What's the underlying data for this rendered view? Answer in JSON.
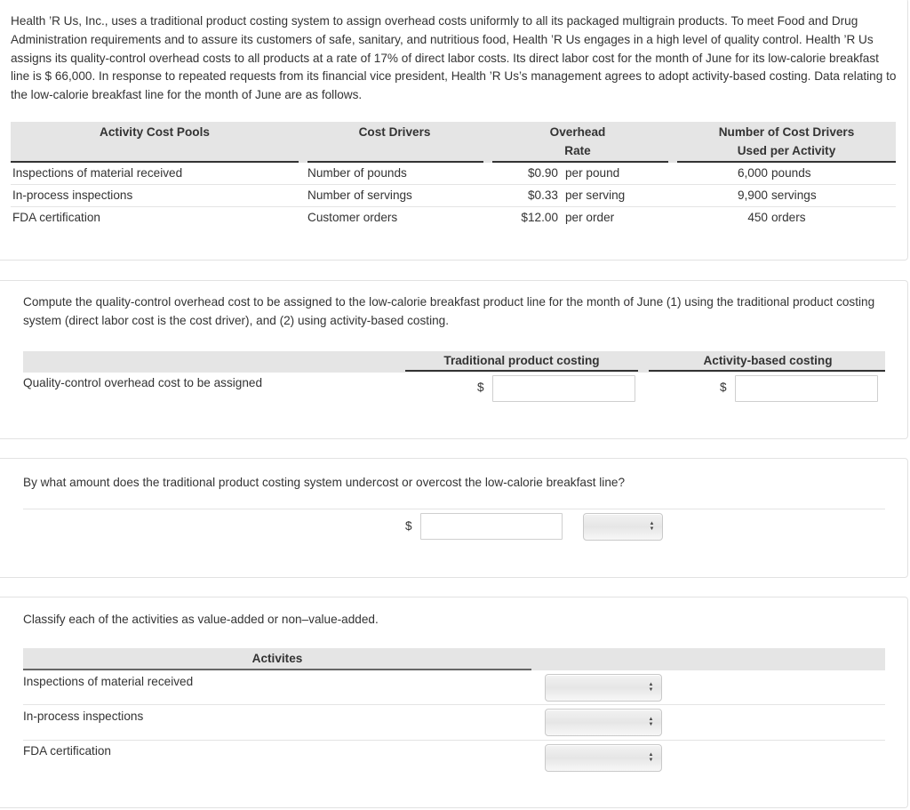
{
  "intro": {
    "text": "Health ’R Us, Inc., uses a traditional product costing system to assign overhead costs uniformly to all its packaged multigrain products. To meet Food and Drug Administration requirements and to assure its customers of safe, sanitary, and nutritious food, Health ’R Us engages in a high level of quality control. Health ’R Us assigns its quality-control overhead costs to all products at a rate of 17% of direct labor costs. Its direct labor cost for the month of June for its low-calorie breakfast line is $ 66,000. In response to repeated requests from its financial vice president, Health ’R Us’s management agrees to adopt activity-based costing. Data relating to the low-calorie breakfast line for the month of June are as follows."
  },
  "activity_table": {
    "headers": {
      "pools": "Activity Cost Pools",
      "drivers": "Cost Drivers",
      "rate_line1": "Overhead",
      "rate_line2": "Rate",
      "count_line1": "Number of Cost Drivers",
      "count_line2": "Used per Activity"
    },
    "rows": [
      {
        "pool": "Inspections of material received",
        "driver": "Number of pounds",
        "rate": "$0.90",
        "rate_unit": "per pound",
        "count": "6,000",
        "count_unit": "pounds"
      },
      {
        "pool": "In-process inspections",
        "driver": "Number of servings",
        "rate": "$0.33",
        "rate_unit": "per serving",
        "count": "9,900",
        "count_unit": "servings"
      },
      {
        "pool": "FDA certification",
        "driver": "Customer orders",
        "rate": "$12.00",
        "rate_unit": "per order",
        "count": "450",
        "count_unit": "orders"
      }
    ]
  },
  "question1": {
    "prompt": "Compute the quality-control overhead cost to be assigned to the low-calorie breakfast product line for the month of June (1) using the traditional product costing system (direct labor cost is the cost driver), and (2) using activity-based costing.",
    "col_traditional": "Traditional product costing",
    "col_abc": "Activity-based costing",
    "row_label": "Quality-control overhead cost to be assigned",
    "currency": "$",
    "traditional_value": "",
    "abc_value": ""
  },
  "question2": {
    "prompt": "By what amount does the traditional product costing system undercost or overcost the low-calorie breakfast line?",
    "currency": "$",
    "amount_value": "",
    "direction_selected": ""
  },
  "question3": {
    "prompt": "Classify each of the activities as value-added or non–value-added.",
    "header": "Activites",
    "rows": [
      {
        "label": "Inspections of material received",
        "selected": ""
      },
      {
        "label": "In-process inspections",
        "selected": ""
      },
      {
        "label": "FDA certification",
        "selected": ""
      }
    ]
  },
  "icons": {
    "select_arrows_up": "▲",
    "select_arrows_down": "▼"
  }
}
